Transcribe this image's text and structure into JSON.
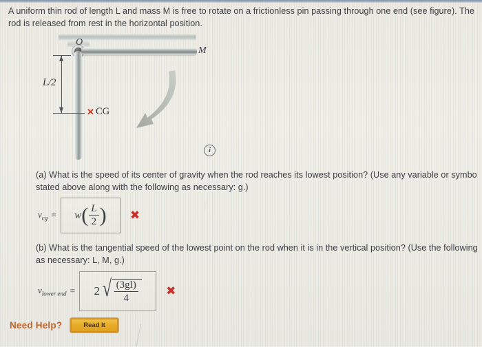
{
  "problem": {
    "statement_line1": "A uniform thin rod of length L and mass M is free to rotate on a frictionless pin passing through one end (see figure). The",
    "statement_line2": "rod is released from rest in the horizontal position."
  },
  "figure": {
    "label_pivot": "O",
    "label_mass": "M",
    "label_half_length": "L/2",
    "label_cg": "CG",
    "cg_marker": "✕",
    "info_icon_glyph": "i",
    "rod_color": "#9ea5a3",
    "cg_marker_color": "#c0392b"
  },
  "part_a": {
    "question_line1": "(a) What is the speed of its center of gravity when the rod reaches its lowest position? (Use any variable or symbo",
    "question_line2": "stated above along with the following as necessary: g.)",
    "answer_label": "v",
    "answer_subscript": "cg",
    "equals": "=",
    "answer_value": "w(L/2)",
    "answer_numerator": "L",
    "answer_denominator": "2",
    "answer_function": "w",
    "status_mark": "✖",
    "status": "incorrect",
    "status_color": "#cc2f2a"
  },
  "part_b": {
    "question_line1": "(b) What is the tangential speed of the lowest point on the rod when it is in the vertical position? (Use the following",
    "question_line2": "as necessary: L, M, g.)",
    "answer_label": "v",
    "answer_subscript": "lower end",
    "equals": "=",
    "answer_value": "2√((3gl)/4)",
    "answer_coefficient": "2",
    "answer_numerator": "(3gl)",
    "answer_denominator": "4",
    "status_mark": "✖",
    "status": "incorrect",
    "status_color": "#cc2f2a"
  },
  "help": {
    "label": "Need Help?",
    "button_label": "Read It",
    "label_color": "#c4642b",
    "button_color": "#e8ad28"
  }
}
